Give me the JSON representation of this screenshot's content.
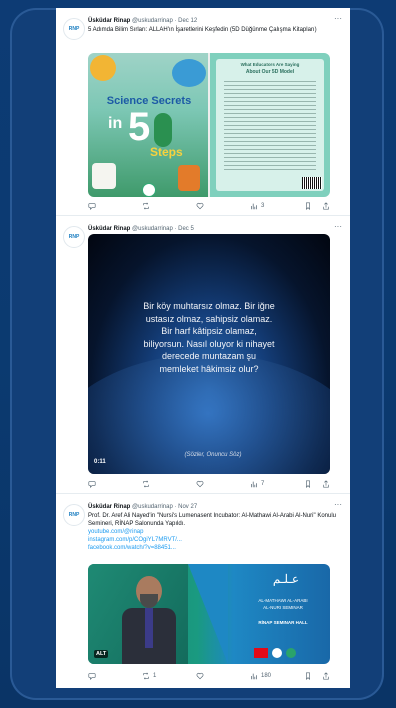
{
  "tweets": [
    {
      "name": "Üsküdar Rinap",
      "handle": "@uskudarrinap",
      "date": "Dec 12",
      "text": "5 Adımda Bilim Sırları: ALLAH'ın İşaretlerini Keşfedin (5D Düğünme Çalışma Kitapları)",
      "media": {
        "cover_title_top": "Science Secrets",
        "cover_in": "in",
        "cover_five": "5",
        "cover_steps": "Steps",
        "back_title_1": "What Educators Are Saying",
        "back_title_2": "About Our 5D Model"
      },
      "stats": {
        "views": "3"
      }
    },
    {
      "name": "Üsküdar Rinap",
      "handle": "@uskudarrinap",
      "date": "Dec 5",
      "video": {
        "quote": "Bir köy muhtarsız olmaz. Bir iğne ustasız olmaz, sahipsiz olamaz. Bir harf kâtipsiz olamaz, biliyorsun. Nasıl oluyor ki nihayet derecede muntazam şu memleket hâkimsiz olur?",
        "signature": "(Sözler, Onuncu Söz)",
        "duration": "0:11"
      },
      "stats": {
        "views": "7"
      }
    },
    {
      "name": "Üsküdar Rinap",
      "handle": "@uskudarrinap",
      "date": "Nov 27",
      "text": "Prof. Dr. Aref Ali Nayed'in \"Nursi's Lumenasent Incubator: Al-Mathawi Al-Arabi Al-Nuri\" Konulu Semineri, RİNAP Salonunda Yapıldı.",
      "links": [
        "youtube.com/@rinap",
        "instagram.com/p/COgiYL7MRVT/...",
        "facebook.com/watch/?v=88451..."
      ],
      "media": {
        "badge": "ALT",
        "banner_line1": "AL-MATHAWI AL-ARABI",
        "banner_line2": "AL-NURI SEMINAR",
        "banner_line3": "RİNAP SEMINAR HALL"
      },
      "stats": {
        "replies": "1",
        "views": "180"
      }
    }
  ],
  "colors": {
    "page_bg": "#0d3b74",
    "link": "#1d9bf0",
    "meta": "#536471"
  }
}
